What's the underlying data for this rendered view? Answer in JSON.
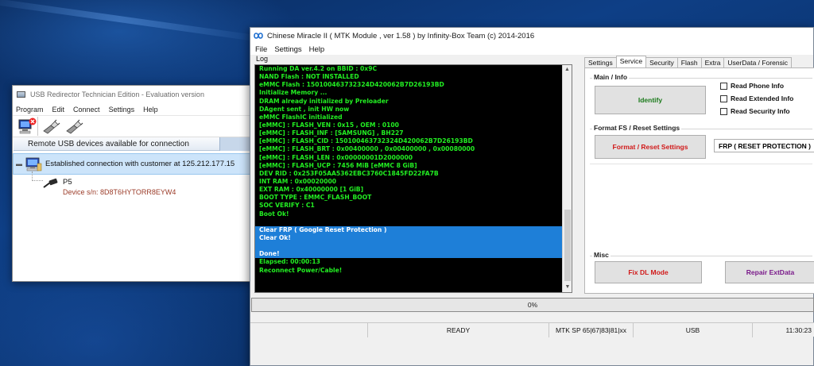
{
  "usb_window": {
    "title": "USB Redirector Technician Edition - Evaluation version",
    "menu": [
      "Program",
      "Edit",
      "Connect",
      "Settings",
      "Help"
    ],
    "toolbar_icons": [
      "disconnect-pc-icon",
      "usb-plug-icon",
      "usb-plug-icon"
    ],
    "panel_header": "Remote USB devices available for connection",
    "connection": "Established connection with customer at 125.212.177.15",
    "device": {
      "name": "P5",
      "serial": "Device s/n: 8D8T6HYTORR8EYW4"
    }
  },
  "cm_window": {
    "title": "Chinese Miracle II ( MTK Module , ver 1.58 ) by Infinity-Box Team (c) 2014-2016",
    "menu": [
      "File",
      "Settings",
      "Help"
    ],
    "log_label": "Log",
    "log_lines": [
      "Running DA ver.4.2 on BBID : 0x9C",
      "NAND Flash : NOT INSTALLED",
      "eMMC Flash : 150100463732324D420062B7D26193BD",
      "Initialize Memory ...",
      "DRAM already initialized by Preloader",
      "DAgent sent , init HW now",
      "eMMC FlashIC initialized",
      "[eMMC] : FLASH_VEN : 0x15 , OEM : 0100",
      "[eMMC] : FLASH_INF : [SAMSUNG] , BH227",
      "[eMMC] : FLASH_CID : 150100463732324D420062B7D26193BD",
      "[eMMC] : FLASH_BRT : 0x00400000 , 0x00400000 , 0x00080000",
      "[eMMC] : FLASH_LEN : 0x00000001D2000000",
      "[eMMC] : FLASH_UCP : 7456 MiB [eMMC 8 GiB]",
      "DEV RID    : 0x253F05AA5362EBC3760C1845FD22FA7B",
      "INT RAM    : 0x00020000",
      "EXT RAM    : 0x40000000 [1 GiB]",
      "BOOT TYPE  : EMMC_FLASH_BOOT",
      "SOC VERIFY : C1",
      "Boot Ok!",
      "",
      "Clear FRP ( Google Reset Protection )",
      "Clear Ok!",
      "",
      "Done!",
      "Elapsed: 00:00:13",
      "Reconnect Power/Cable!"
    ],
    "highlighted_lines": [
      20,
      21,
      22,
      23
    ],
    "tabs": [
      "Settings",
      "Service",
      "Security",
      "Flash",
      "Extra",
      "UserData / Forensic"
    ],
    "active_tab": "Service",
    "main_info": {
      "title": "Main / Info",
      "identify": "Identify",
      "checkboxes": [
        "Read Phone Info",
        "Read Extended Info",
        "Read Security Info"
      ]
    },
    "format": {
      "title": "Format FS / Reset Settings",
      "button": "Format / Reset Settings",
      "combo_value": "FRP ( RESET PROTECTION )"
    },
    "misc": {
      "title": "Misc",
      "fix_dl": "Fix DL Mode",
      "repair": "Repair ExtData"
    },
    "progress": {
      "value": 0,
      "text": "0%"
    },
    "status": {
      "state": "READY",
      "platform": "MTK SP 65|67|83|81|xx",
      "port": "USB",
      "time": "11:30:23"
    },
    "colors": {
      "log_text": "#22ee22",
      "log_highlight": "#1e7fd8",
      "identify_text": "#1a7a1a",
      "format_text": "#d11a1a",
      "fix_dl_text": "#d11a1a",
      "repair_text": "#7a1a8a"
    }
  }
}
